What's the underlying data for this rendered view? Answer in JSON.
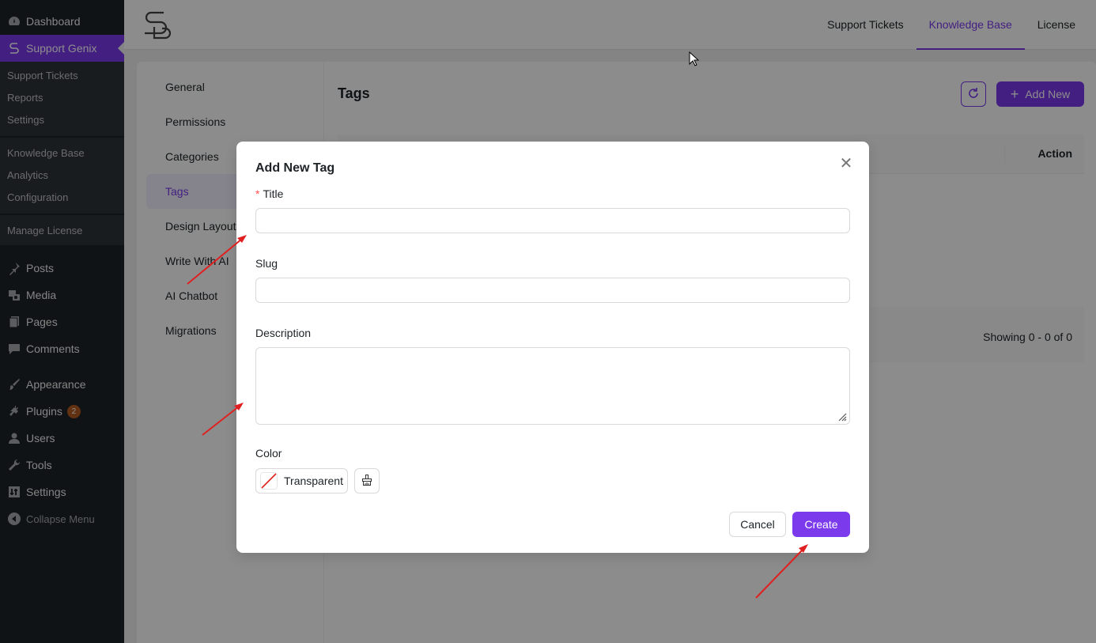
{
  "colors": {
    "accent": "#7c3aed",
    "sidebar_bg": "#1d2327",
    "annotation": "#e02020"
  },
  "wp_menu": {
    "dashboard": {
      "label": "Dashboard",
      "icon": "dashboard-icon"
    },
    "support_genix": {
      "label": "Support Genix",
      "icon": "support-genix-icon"
    },
    "submenu": [
      "Support Tickets",
      "Reports",
      "Settings",
      "Knowledge Base",
      "Analytics",
      "Configuration",
      "Manage License"
    ],
    "items": [
      {
        "label": "Posts",
        "icon": "pin-icon"
      },
      {
        "label": "Media",
        "icon": "media-icon"
      },
      {
        "label": "Pages",
        "icon": "pages-icon"
      },
      {
        "label": "Comments",
        "icon": "comment-icon"
      },
      {
        "label": "Appearance",
        "icon": "brush-icon"
      },
      {
        "label": "Plugins",
        "icon": "plug-icon",
        "badge": "2"
      },
      {
        "label": "Users",
        "icon": "user-icon"
      },
      {
        "label": "Tools",
        "icon": "wrench-icon"
      },
      {
        "label": "Settings",
        "icon": "settings-icon"
      },
      {
        "label": "Collapse Menu",
        "icon": "collapse-icon"
      }
    ]
  },
  "top_nav": [
    "Support Tickets",
    "Knowledge Base",
    "License"
  ],
  "settings_nav": [
    "General",
    "Permissions",
    "Categories",
    "Tags",
    "Design Layout",
    "Write With AI",
    "AI Chatbot",
    "Migrations"
  ],
  "tags_panel": {
    "title": "Tags",
    "add_new_label": "Add New",
    "action_col": "Action",
    "showing": "Showing 0 - 0 of 0"
  },
  "modal": {
    "title": "Add New Tag",
    "title_label": "Title",
    "title_value": "",
    "slug_label": "Slug",
    "slug_value": "",
    "description_label": "Description",
    "description_value": "",
    "color_label": "Color",
    "color_value": "Transparent",
    "cancel_label": "Cancel",
    "create_label": "Create"
  }
}
